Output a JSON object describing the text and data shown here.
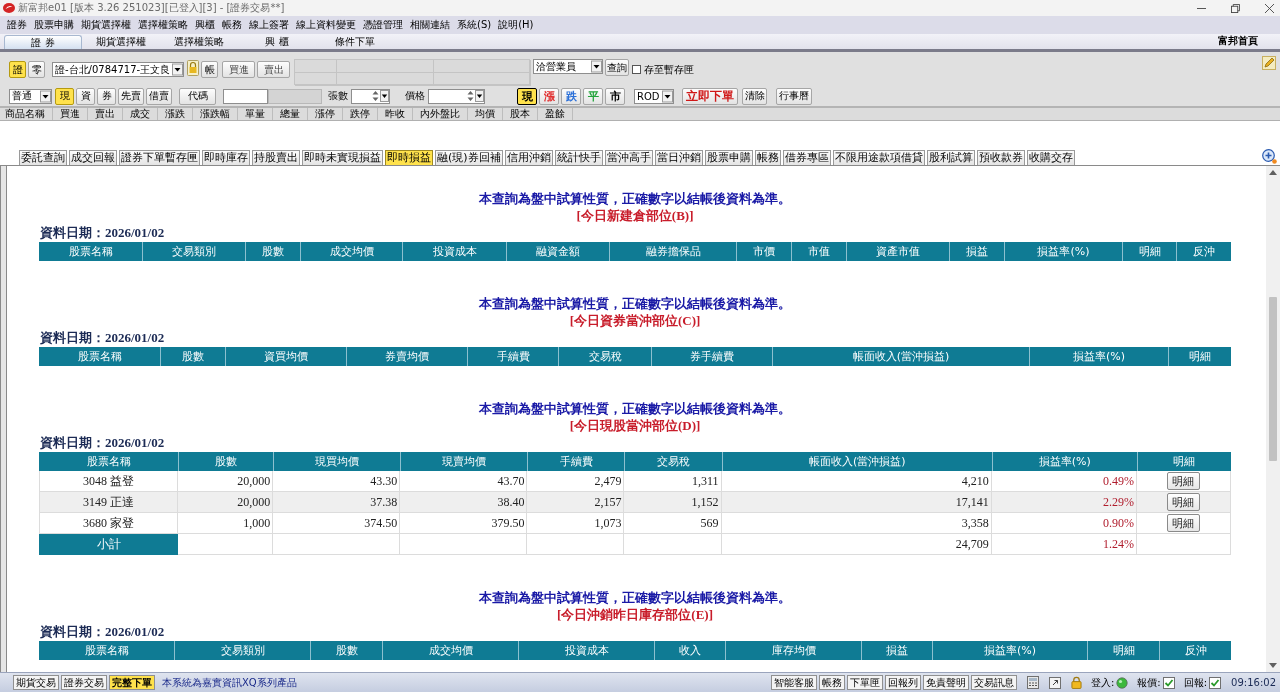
{
  "window": {
    "title": "新富邦e01 [版本 3.26 251023][已登入][3] - [證券交易**]"
  },
  "menu": [
    "證券",
    "股票申購",
    "期貨選擇權",
    "選擇權策略",
    "興櫃",
    "帳務",
    "線上簽署",
    "線上資料變更",
    "憑證管理",
    "相關連結",
    "系統(S)",
    "說明(H)"
  ],
  "module_tabs": [
    {
      "label": "證 券",
      "selected": true
    },
    {
      "label": "期貨選擇權",
      "selected": false
    },
    {
      "label": "選擇權策略",
      "selected": false
    },
    {
      "label": "興 櫃",
      "selected": false
    },
    {
      "label": "條件下單",
      "selected": false
    }
  ],
  "home_link": "富邦首頁",
  "order_panel": {
    "market_buttons": [
      {
        "label": "證",
        "selected": true
      },
      {
        "label": "零",
        "selected": false
      }
    ],
    "account": "證-台北/0784717-王文良",
    "account_button": "帳",
    "side_buttons": [
      "買進",
      "賣出"
    ],
    "salesperson": "洽營業員",
    "query_button": "查詢",
    "save_to_draft": {
      "label": "存至暫存匣",
      "checked": false
    },
    "order_type": "普通",
    "trade_types": [
      {
        "label": "現",
        "selected": true
      },
      {
        "label": "資",
        "selected": false
      },
      {
        "label": "券",
        "selected": false
      },
      {
        "label": "先賣",
        "selected": false
      },
      {
        "label": "借賣",
        "selected": false
      }
    ],
    "code_button": "代碼",
    "quantity_label": "張數",
    "price_label": "價格",
    "price_types": [
      {
        "label": "現",
        "selected": true,
        "color": "#000000"
      },
      {
        "label": "漲",
        "selected": false,
        "color": "#e02828"
      },
      {
        "label": "跌",
        "selected": false,
        "color": "#2a6fd8"
      },
      {
        "label": "平",
        "selected": false,
        "color": "#22a33a"
      },
      {
        "label": "市",
        "selected": false,
        "color": "#000000"
      }
    ],
    "time_in_force": "ROD",
    "submit_button": "立即下單",
    "clear_button": "清除",
    "calendar_button": "行事曆"
  },
  "quote_table": {
    "columns": [
      "商品名稱",
      "買進",
      "賣出",
      "成交",
      "漲跌",
      "漲跌幅",
      "單量",
      "總量",
      "漲停",
      "跌停",
      "昨收",
      "內外盤比",
      "均價",
      "股本",
      "盈餘"
    ]
  },
  "function_tabs": [
    {
      "label": "委託查詢",
      "selected": false
    },
    {
      "label": "成交回報",
      "selected": false
    },
    {
      "label": "證券下單暫存匣",
      "selected": false
    },
    {
      "label": "即時庫存",
      "selected": false
    },
    {
      "label": "持股賣出",
      "selected": false
    },
    {
      "label": "即時未實現損益",
      "selected": false
    },
    {
      "label": "即時損益",
      "selected": true
    },
    {
      "label": "融(現)券回補",
      "selected": false
    },
    {
      "label": "信用沖銷",
      "selected": false
    },
    {
      "label": "統計快手",
      "selected": false
    },
    {
      "label": "當沖高手",
      "selected": false
    },
    {
      "label": "當日沖銷",
      "selected": false
    },
    {
      "label": "股票申購",
      "selected": false
    },
    {
      "label": "帳務",
      "selected": false
    },
    {
      "label": "借券專區",
      "selected": false
    },
    {
      "label": "不限用途款項借貸",
      "selected": false
    },
    {
      "label": "股利試算",
      "selected": false
    },
    {
      "label": "預收款券",
      "selected": false
    },
    {
      "label": "收購交存",
      "selected": false
    }
  ],
  "sections": [
    {
      "notice": "本查詢為盤中試算性質，正確數字以結帳後資料為準。",
      "title": "[今日新建倉部位(B)]",
      "date": "資料日期：2026/01/02",
      "columns": [
        "股票名稱",
        "交易類別",
        "股數",
        "成交均價",
        "投資成本",
        "融資金額",
        "融券擔保品",
        "市價",
        "市值",
        "資產市值",
        "損益",
        "損益率(%)",
        "明細",
        "反沖"
      ]
    },
    {
      "notice": "本查詢為盤中試算性質，正確數字以結帳後資料為準。",
      "title": "[今日資券當沖部位(C)]",
      "date": "資料日期：2026/01/02",
      "columns": [
        "股票名稱",
        "股數",
        "資買均價",
        "券賣均價",
        "手續費",
        "交易稅",
        "券手續費",
        "帳面收入(當沖損益)",
        "損益率(%)",
        "明細"
      ]
    },
    {
      "notice": "本查詢為盤中試算性質，正確數字以結帳後資料為準。",
      "title": "[今日現股當沖部位(D)]",
      "date": "資料日期：2026/01/02",
      "columns": [
        "股票名稱",
        "股數",
        "現買均價",
        "現賣均價",
        "手續費",
        "交易稅",
        "帳面收入(當沖損益)",
        "損益率(%)",
        "明細"
      ],
      "rows": [
        {
          "cells": [
            "3048 益登",
            "20,000",
            "43.30",
            "43.70",
            "2,479",
            "1,311",
            "4,210"
          ],
          "pnl_rate": "0.49%",
          "detail": "明細"
        },
        {
          "cells": [
            "3149 正達",
            "20,000",
            "37.38",
            "38.40",
            "2,157",
            "1,152",
            "17,141"
          ],
          "pnl_rate": "2.29%",
          "detail": "明細"
        },
        {
          "cells": [
            "3680 家登",
            "1,000",
            "374.50",
            "379.50",
            "1,073",
            "569",
            "3,358"
          ],
          "pnl_rate": "0.90%",
          "detail": "明細"
        }
      ],
      "subtotal": {
        "label": "小計",
        "book_income": "24,709",
        "pnl_rate": "1.24%"
      }
    },
    {
      "notice": "本查詢為盤中試算性質，正確數字以結帳後資料為準。",
      "title": "[今日沖銷昨日庫存部位(E)]",
      "date": "資料日期：2026/01/02",
      "columns": [
        "股票名稱",
        "交易類別",
        "股數",
        "成交均價",
        "投資成本",
        "收入",
        "庫存均價",
        "損益",
        "損益率(%)",
        "明細",
        "反沖"
      ]
    }
  ],
  "status_bar": {
    "tabs": [
      {
        "label": "期貨交易",
        "selected": false
      },
      {
        "label": "證券交易",
        "selected": false
      },
      {
        "label": "完整下單",
        "selected": true
      }
    ],
    "notice": "本系統為嘉實資訊XQ系列產品",
    "buttons": [
      "智能客服",
      "帳務",
      "下單匣",
      "回報列",
      "免責聲明",
      "交易訊息"
    ],
    "indicators": [
      {
        "label": "登入:",
        "kind": "dot",
        "on": true
      },
      {
        "label": "報價:",
        "kind": "check",
        "on": true
      },
      {
        "label": "回報:",
        "kind": "check",
        "on": true
      }
    ],
    "time": "09:16:02"
  }
}
